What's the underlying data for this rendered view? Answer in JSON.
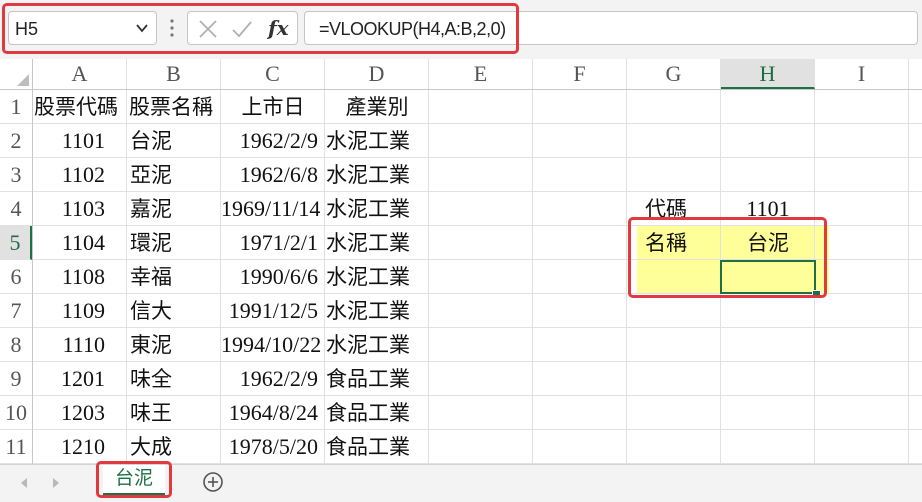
{
  "formula_bar": {
    "name_box": "H5",
    "formula": "=VLOOKUP(H4,A:B,2,0)",
    "fx_label": "fx"
  },
  "columns": [
    "A",
    "B",
    "C",
    "D",
    "E",
    "F",
    "G",
    "H",
    "I"
  ],
  "rows": [
    "1",
    "2",
    "3",
    "4",
    "5",
    "6",
    "7",
    "8",
    "9",
    "10",
    "11"
  ],
  "table": {
    "headers": [
      "股票代碼",
      "股票名稱",
      "上市日",
      "產業別"
    ],
    "records": [
      [
        "1101",
        "台泥",
        "1962/2/9",
        "水泥工業"
      ],
      [
        "1102",
        "亞泥",
        "1962/6/8",
        "水泥工業"
      ],
      [
        "1103",
        "嘉泥",
        "1969/11/14",
        "水泥工業"
      ],
      [
        "1104",
        "環泥",
        "1971/2/1",
        "水泥工業"
      ],
      [
        "1108",
        "幸福",
        "1990/6/6",
        "水泥工業"
      ],
      [
        "1109",
        "信大",
        "1991/12/5",
        "水泥工業"
      ],
      [
        "1110",
        "東泥",
        "1994/10/22",
        "水泥工業"
      ],
      [
        "1201",
        "味全",
        "1962/2/9",
        "食品工業"
      ],
      [
        "1203",
        "味王",
        "1964/8/24",
        "食品工業"
      ],
      [
        "1210",
        "大成",
        "1978/5/20",
        "食品工業"
      ]
    ]
  },
  "lookup": {
    "code_label": "代碼",
    "code_value": "1101",
    "name_label": "名稱",
    "name_value": "台泥"
  },
  "selected_cell": {
    "column": "H",
    "row": "5"
  },
  "sheet_tabs": [
    "台泥"
  ],
  "colors": {
    "accent": "#1e7145",
    "highlight": "#ffff99",
    "annotation": "#e0393e"
  }
}
